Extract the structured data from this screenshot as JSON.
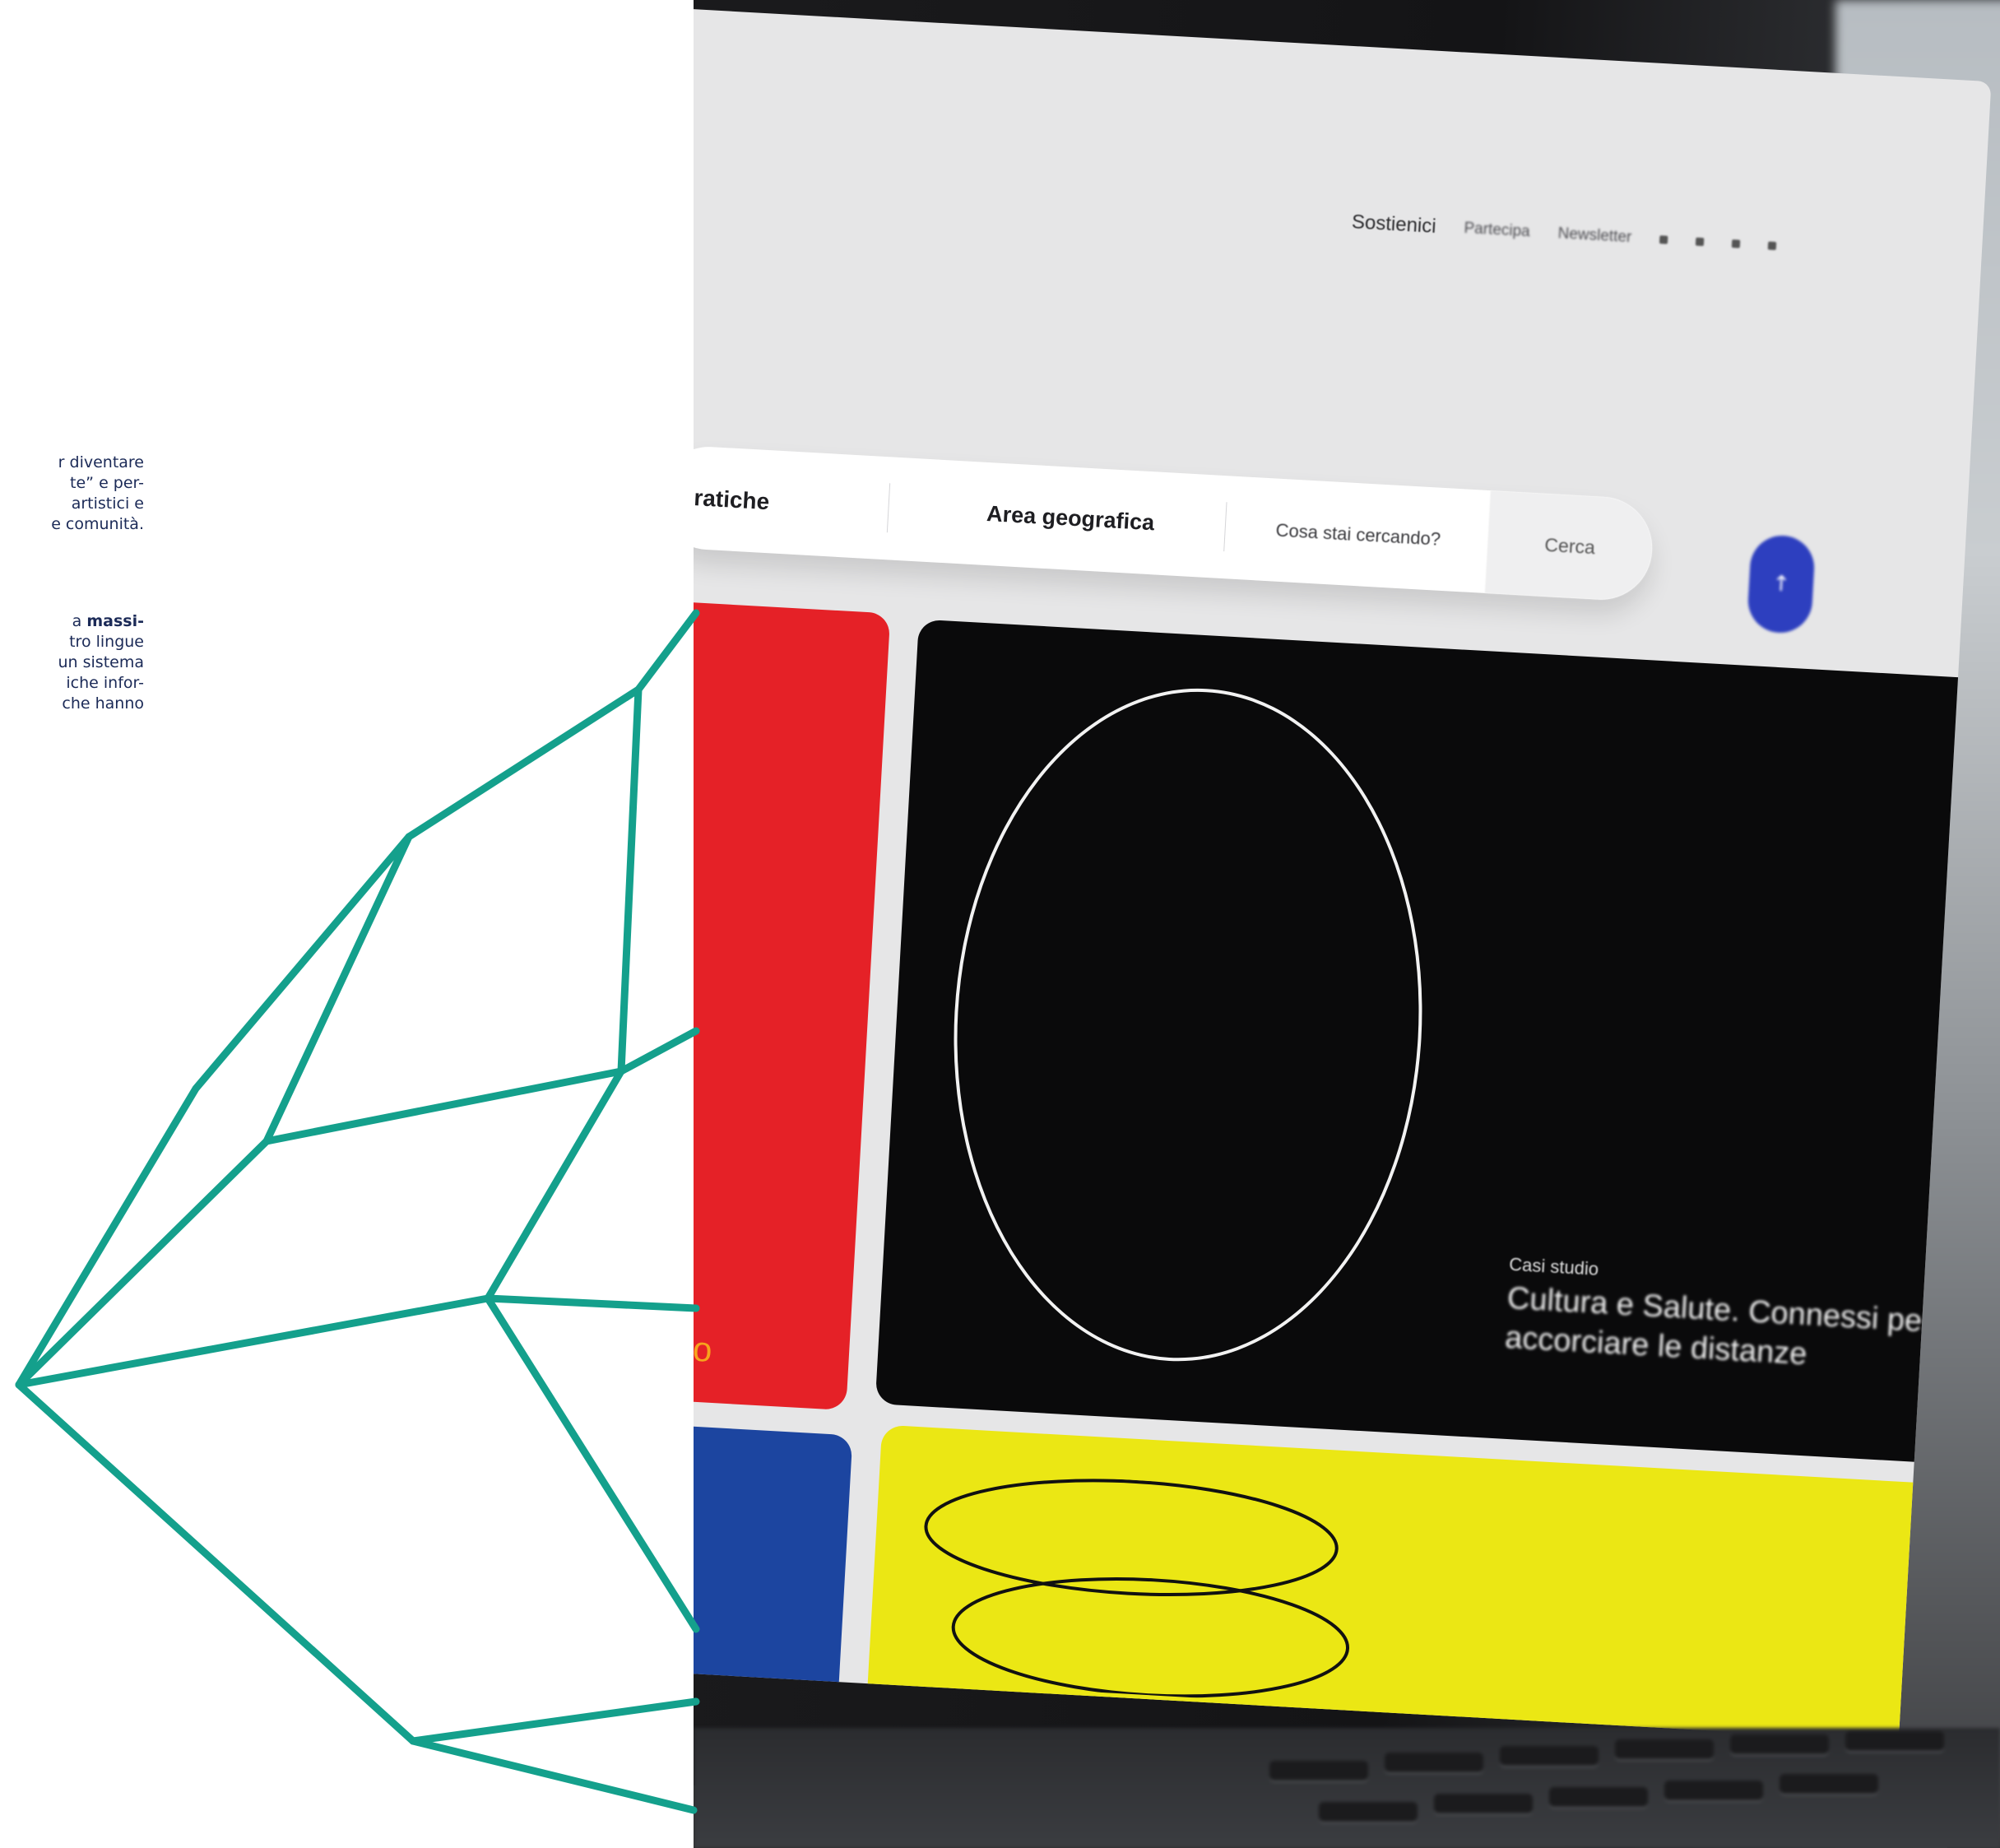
{
  "article": {
    "paragraph1": [
      "r diventare",
      "te” e per-",
      " artistici e",
      "e comunità."
    ],
    "paragraph2_bold_fragment": "massi-",
    "paragraph2_first_prefix": "a ",
    "paragraph2": [
      "tro lingue",
      "un sistema",
      "iche infor-",
      " che hanno"
    ]
  },
  "colors": {
    "accent_teal": "#14a08c",
    "text_navy": "#1b2a57",
    "tile_red": "#e52127",
    "tile_black": "#0a0a0b",
    "tile_blue": "#1c45a0",
    "tile_yellow": "#ebe714",
    "fab_blue": "#2d3fbf"
  },
  "website": {
    "top_nav": [
      "Sostienici",
      "Partecipa",
      "Newsletter"
    ],
    "search_bar": {
      "filter_1": "Pratiche",
      "filter_2": "Area geografica",
      "placeholder": "Cosa stai cercando?",
      "button": "Cerca"
    },
    "fab_icon": "arrow-up-icon",
    "tiles": {
      "red_label": "e curano",
      "case_label": "Casi studio",
      "case_title": "Cultura e Salute. Connessi per accorciare le distanze"
    }
  }
}
